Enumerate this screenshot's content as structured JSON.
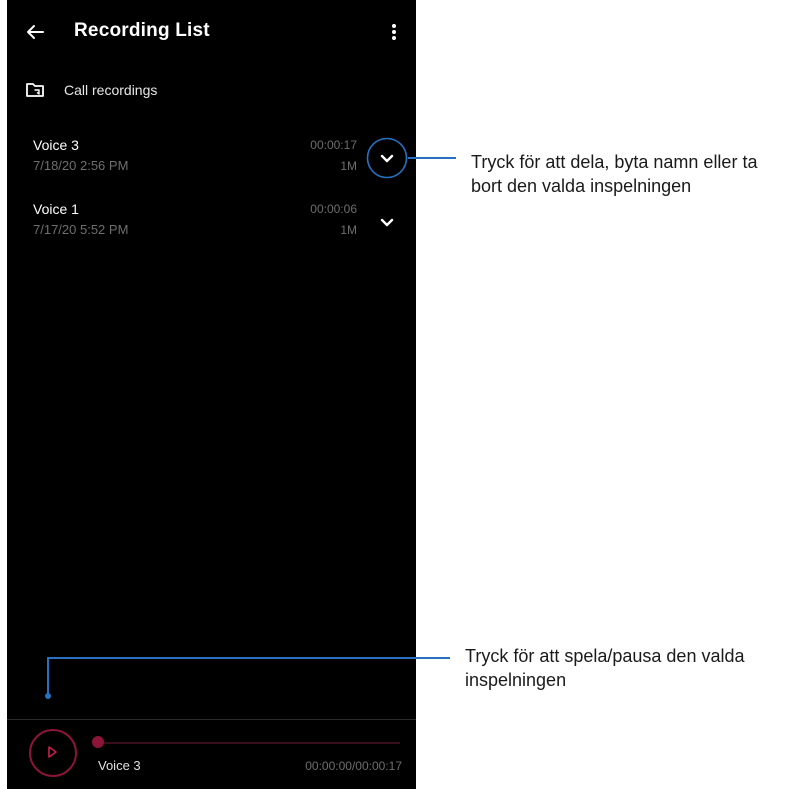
{
  "header": {
    "title": "Recording List"
  },
  "folder": {
    "label": "Call recordings"
  },
  "recordings": [
    {
      "name": "Voice 3",
      "date": "7/18/20 2:56 PM",
      "duration": "00:00:17",
      "size": "1M"
    },
    {
      "name": "Voice 1",
      "date": "7/17/20 5:52 PM",
      "duration": "00:00:06",
      "size": "1M"
    }
  ],
  "player": {
    "name": "Voice 3",
    "time": "00:00:00/00:00:17",
    "progress": 0
  },
  "callouts": {
    "expand": "Tryck för att dela, byta namn eller ta bort den valda inspelningen",
    "play": "Tryck för att spela/pausa den valda inspelningen"
  },
  "colors": {
    "accent": "#8a1538",
    "callout": "#2672c0",
    "background": "#000000"
  }
}
